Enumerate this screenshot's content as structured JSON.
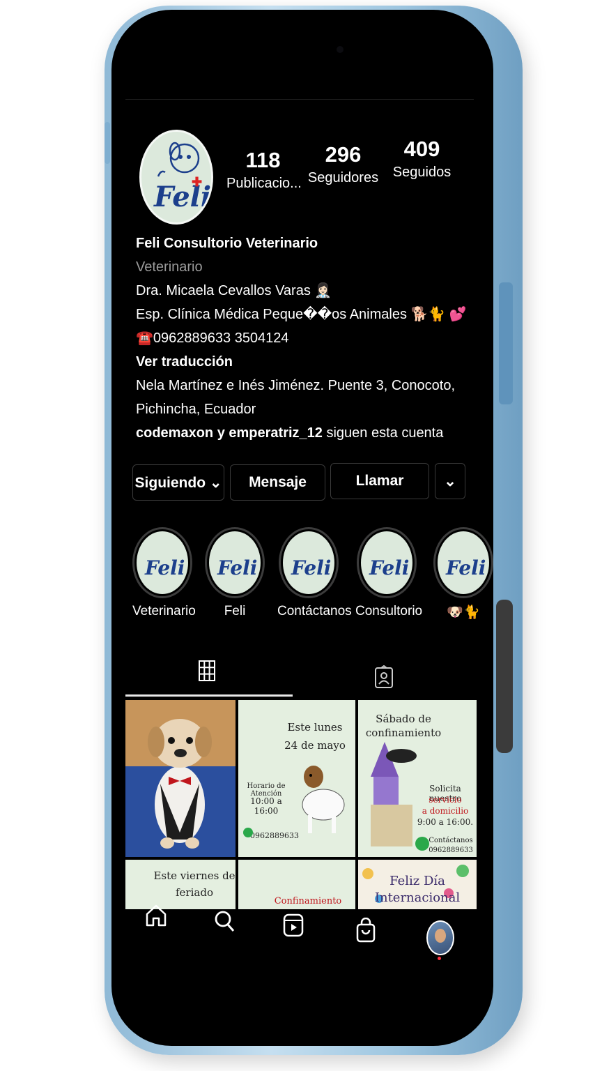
{
  "profile": {
    "avatar_logo": "Feli",
    "stats": [
      {
        "value": "118",
        "label": "Publicacio..."
      },
      {
        "value": "296",
        "label": "Seguidores"
      },
      {
        "value": "409",
        "label": "Seguidos"
      }
    ]
  },
  "bio": {
    "name": "Feli Consultorio Veterinario",
    "category": "Veterinario",
    "line1": "Dra. Micaela Cevallos Varas 👩🏻‍⚕️",
    "line2": "Esp. Clínica Médica Peque��os Animales 🐕🐈 💕",
    "line3": "☎️0962889633 3504124",
    "translate": "Ver traducción",
    "address1": "Nela Martínez e Inés Jiménez. Puente 3, Conocoto,",
    "address2": "Pichincha, Ecuador",
    "followers_bold": "codemaxon y emperatriz_12",
    "followers_rest": " siguen esta cuenta"
  },
  "actions": {
    "following": "Siguiendo ⌄",
    "message": "Mensaje",
    "call": "Llamar",
    "more": "⌄"
  },
  "highlights": [
    {
      "label": "Veterinario"
    },
    {
      "label": "Feli"
    },
    {
      "label": "Contáctanos"
    },
    {
      "label": "Consultorio"
    },
    {
      "label": "🐶🐈"
    }
  ],
  "grid": {
    "post2": {
      "line1": "Este lunes",
      "line2": "24 de mayo",
      "hours_title": "Horario de Atención",
      "hours": "10:00 a 16:00",
      "phone": "0962889633"
    },
    "post3": {
      "line1": "Sábado de",
      "line2": "confinamiento",
      "cta1": "Solicita nuestro",
      "cta2": "servicio",
      "cta3": "a domicilio",
      "hours": "9:00 a 16:00.",
      "contact": "Contáctanos",
      "phone": "0962889633"
    },
    "post4": {
      "line1": "Este viernes de",
      "line2": "feriado"
    },
    "post5": {
      "line1": "Confinamiento"
    },
    "post6": {
      "line1": "Feliz Día",
      "line2": "Internacional"
    }
  },
  "icons": {
    "grid_tab": "grid-icon",
    "tagged_tab": "tagged-person-icon",
    "nav": [
      "home-icon",
      "search-icon",
      "reels-icon",
      "shop-icon",
      "profile-avatar"
    ]
  },
  "colors": {
    "background": "#000000",
    "phone_frame": "#9ec6e0",
    "logo_blue": "#1c3f8c",
    "logo_bg": "#dce9dc"
  }
}
